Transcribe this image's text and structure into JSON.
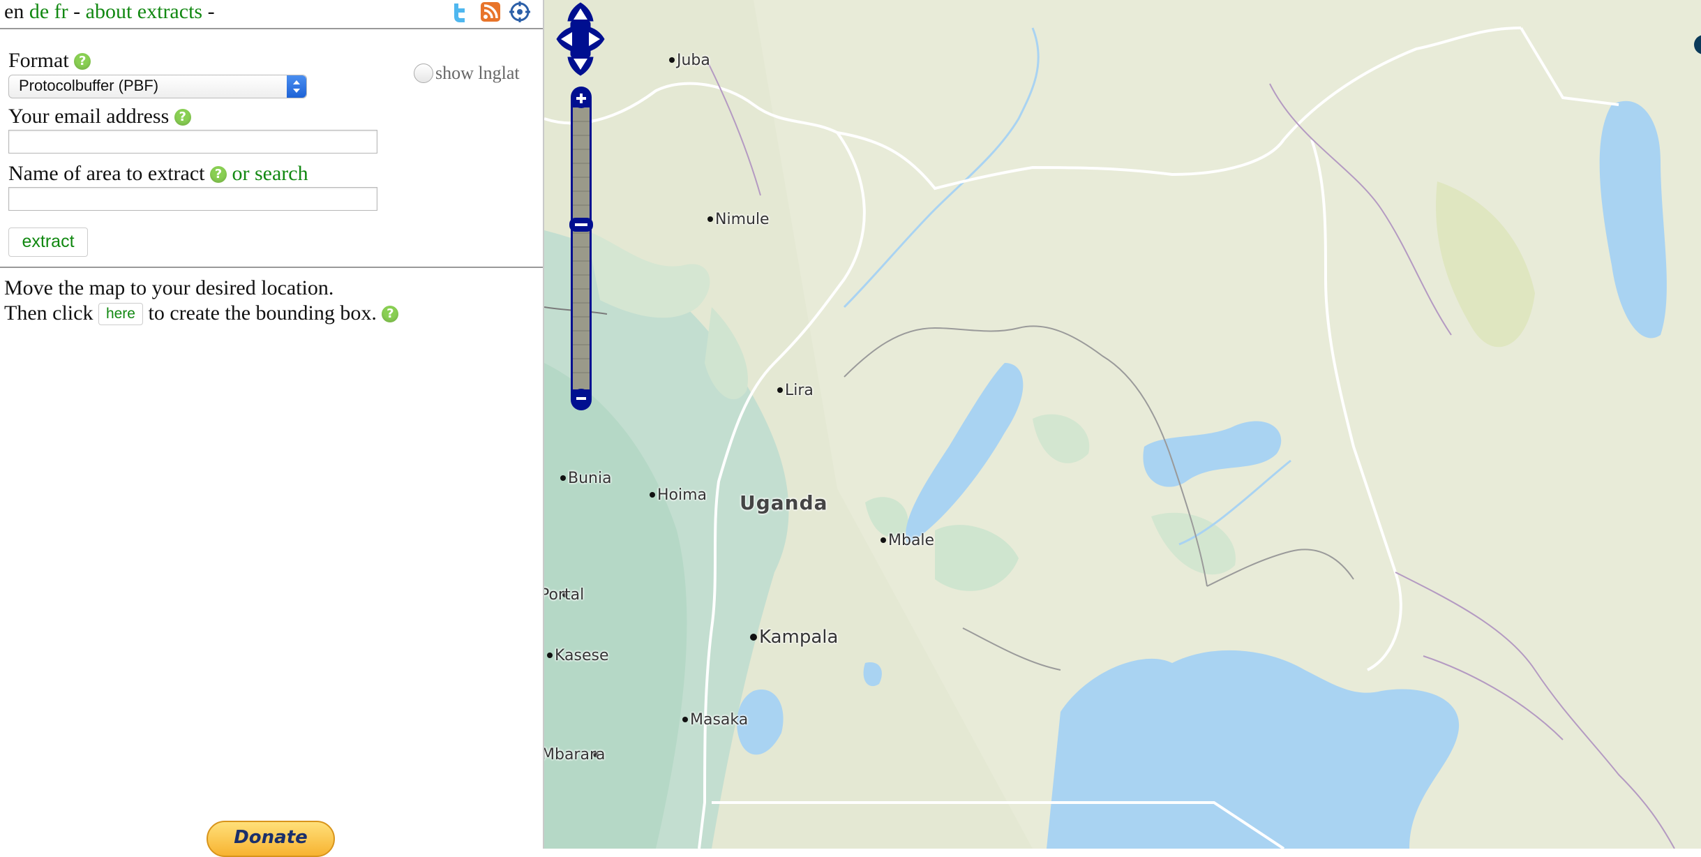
{
  "topbar": {
    "lang_en": "en",
    "lang_de": "de",
    "lang_fr": "fr",
    "sep1": "-",
    "about_link": "about extracts",
    "sep2": "-",
    "icons": [
      "twitter-icon",
      "rss-icon",
      "locate-icon"
    ]
  },
  "form": {
    "format_label": "Format",
    "format_value": "Protocolbuffer (PBF)",
    "show_lnglat_label": "show lnglat",
    "email_label": "Your email address",
    "email_value": "",
    "area_label": "Name of area to extract",
    "or_search": "or search",
    "area_value": "",
    "extract_button": "extract"
  },
  "instructions": {
    "line1": "Move the map to your desired location.",
    "line2_before": "Then click",
    "here_button": "here",
    "line2_after": "to create the bounding box."
  },
  "donate_label": "Donate",
  "map": {
    "country_label": "Uganda",
    "cities": [
      {
        "name": "Juba"
      },
      {
        "name": "Nimule"
      },
      {
        "name": "Lira"
      },
      {
        "name": "Bunia"
      },
      {
        "name": "Hoima"
      },
      {
        "name": "Mbale"
      },
      {
        "name": "Fort Portal"
      },
      {
        "name": "Kampala"
      },
      {
        "name": "Kasese"
      },
      {
        "name": "Masaka"
      },
      {
        "name": "Mbarara"
      }
    ],
    "colors": {
      "land": "#e4e8d3",
      "forest": "#c4dfc6",
      "water": "#a9d3f2",
      "border": "#ffffff",
      "control": "#000f90"
    }
  }
}
